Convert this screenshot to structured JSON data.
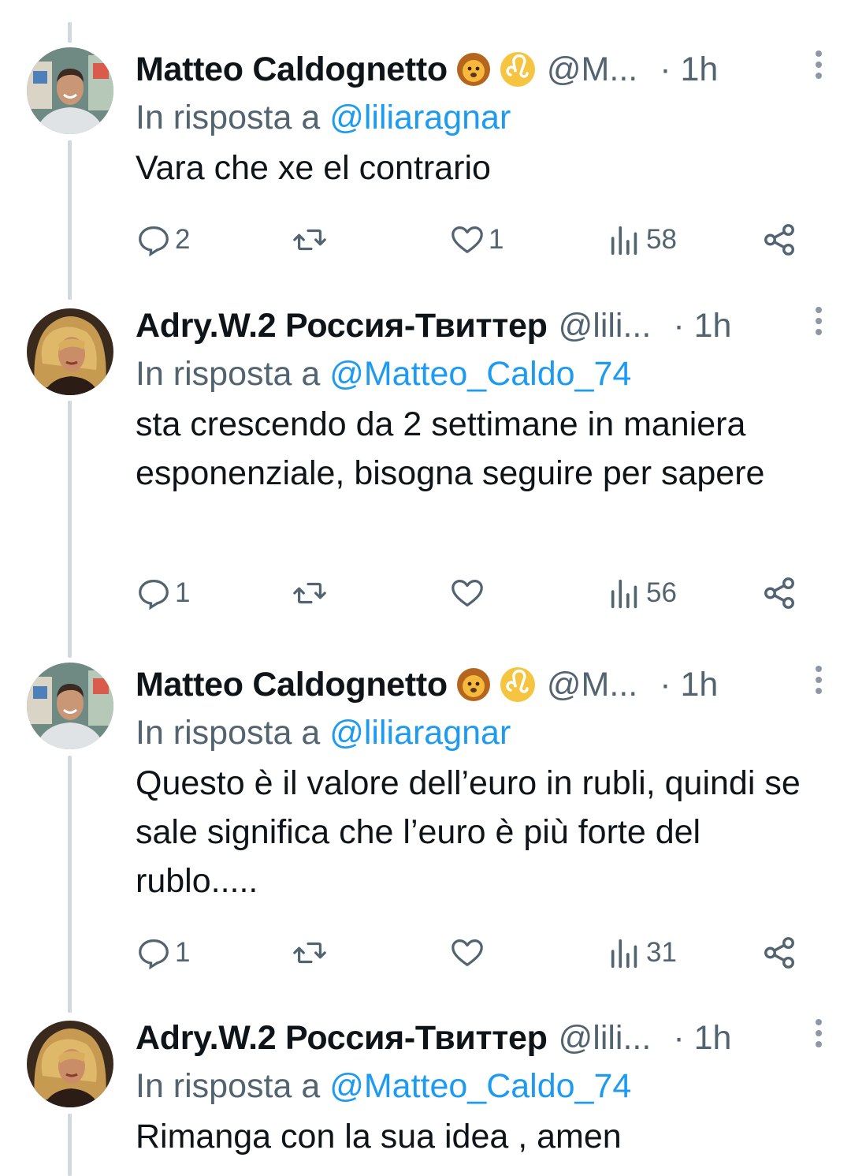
{
  "colors": {
    "accent": "#1d9bf0",
    "secondary": "#536471",
    "thread_line": "#cfd9de"
  },
  "tweets": [
    {
      "name": "Matteo Caldognetto",
      "emojis": [
        "lion-face-emoji",
        "leo-zodiac-emoji"
      ],
      "handle": "@M...",
      "time": "· 1h",
      "reply_prefix": "In risposta a",
      "reply_to": "@liliaragnar",
      "text": "Vara che xe el contrario",
      "replies": "2",
      "likes": "1",
      "views": "58"
    },
    {
      "name": "Adry.W.2 Россия-Твиттер",
      "emojis": [],
      "handle": "@lili...",
      "time": "· 1h",
      "reply_prefix": "In risposta a",
      "reply_to": "@Matteo_Caldo_74",
      "text": "sta crescendo da 2 settimane in maniera esponenziale, bisogna seguire per sapere",
      "replies": "1",
      "likes": "",
      "views": "56"
    },
    {
      "name": "Matteo Caldognetto",
      "emojis": [
        "lion-face-emoji",
        "leo-zodiac-emoji"
      ],
      "handle": "@M...",
      "time": "· 1h",
      "reply_prefix": "In risposta a",
      "reply_to": "@liliaragnar",
      "text": "Questo è il valore dell’euro in rubli, quindi se sale significa che l’euro è più forte del rublo.....",
      "replies": "1",
      "likes": "",
      "views": "31"
    },
    {
      "name": "Adry.W.2 Россия-Твиттер",
      "emojis": [],
      "handle": "@lili...",
      "time": "· 1h",
      "reply_prefix": "In risposta a",
      "reply_to": "@Matteo_Caldo_74",
      "text": "Rimanga con la sua idea , amen"
    }
  ]
}
